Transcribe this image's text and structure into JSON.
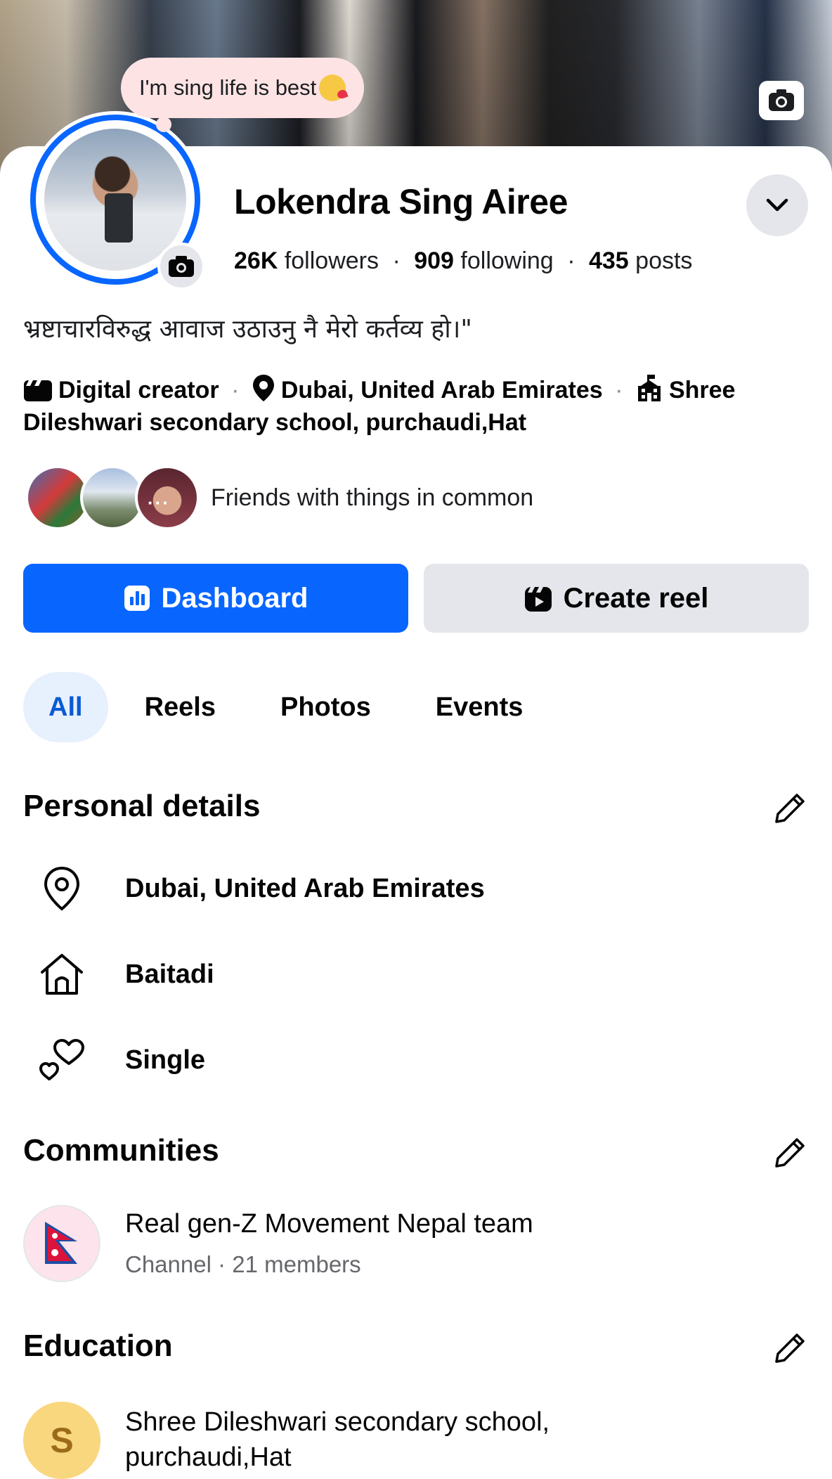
{
  "note": {
    "text": "I'm sing life is best"
  },
  "profile": {
    "name": "Lokendra Sing Airee",
    "followers_count": "26K",
    "followers_label": "followers",
    "following_count": "909",
    "following_label": "following",
    "posts_count": "435",
    "posts_label": "posts",
    "separator": "·",
    "bio": "भ्रष्टाचारविरुद्ध आवाज उठाउनु नै मेरो कर्तव्य हो।\"",
    "category": "Digital creator",
    "location": "Dubai, United Arab Emirates",
    "school_line_1": "Shree",
    "school_line_2": "Dileshwari secondary school, purchaudi,Hat",
    "friends_text": "Friends with things in common",
    "friends_more": "···"
  },
  "actions": {
    "dashboard_label": "Dashboard",
    "create_reel_label": "Create reel"
  },
  "tabs": [
    {
      "label": "All",
      "active": true
    },
    {
      "label": "Reels",
      "active": false
    },
    {
      "label": "Photos",
      "active": false
    },
    {
      "label": "Events",
      "active": false
    }
  ],
  "personal_details": {
    "title": "Personal details",
    "items": [
      {
        "icon": "location-pin-icon",
        "text": "Dubai, United Arab Emirates"
      },
      {
        "icon": "home-icon",
        "text": "Baitadi"
      },
      {
        "icon": "hearts-icon",
        "text": "Single"
      }
    ]
  },
  "communities": {
    "title": "Communities",
    "items": [
      {
        "name": "Real gen-Z Movement Nepal team",
        "meta": "Channel · 21 members"
      }
    ]
  },
  "education": {
    "title": "Education",
    "items": [
      {
        "initial": "S",
        "name": "Shree Dileshwari secondary school, purchaudi,Hat"
      }
    ]
  },
  "colors": {
    "accent": "#0866ff",
    "button_secondary": "#e4e6eb",
    "tab_active_bg": "#e7f0fd",
    "note_bg": "#fde3e4"
  }
}
